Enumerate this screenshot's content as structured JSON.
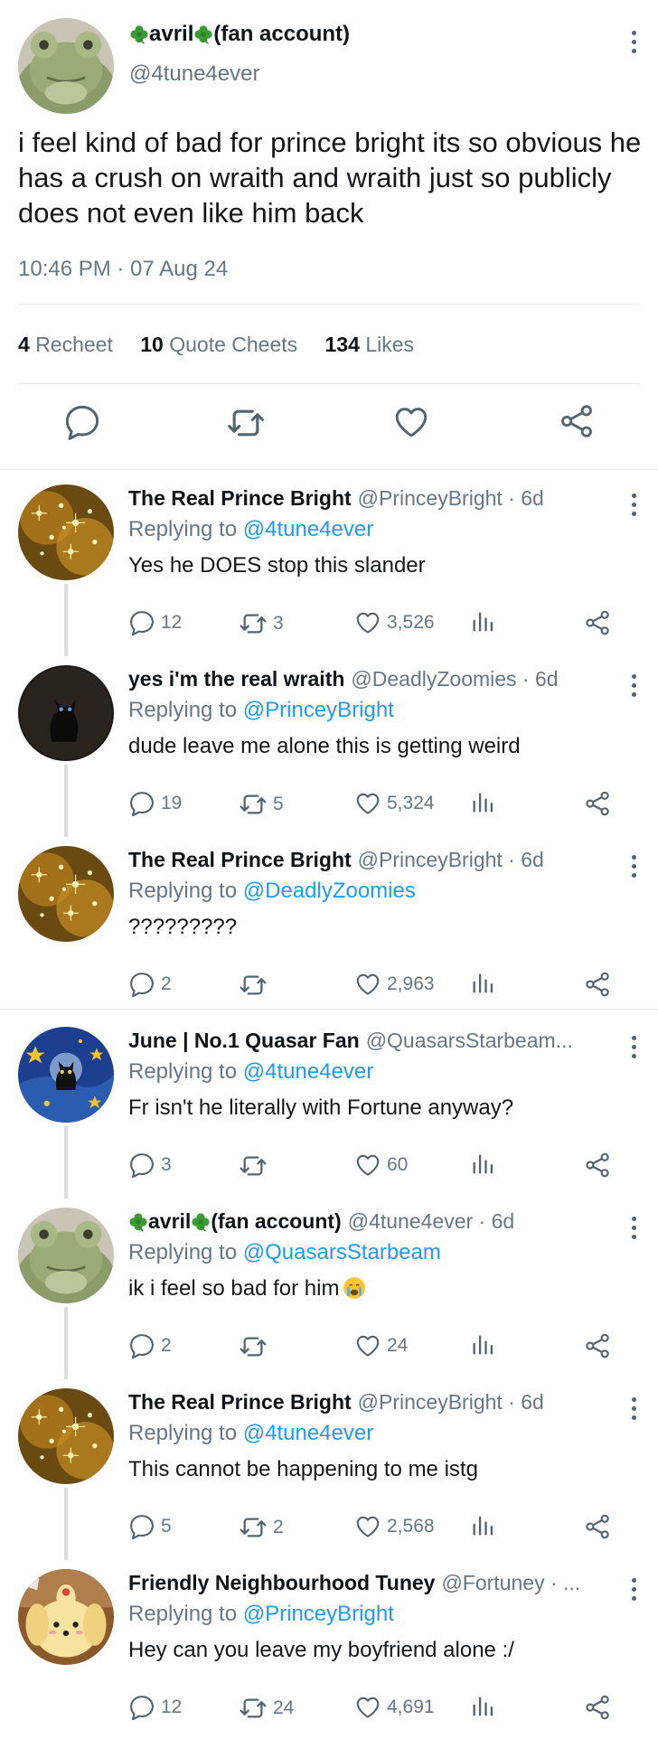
{
  "main_tweet": {
    "display_name": "avril",
    "display_suffix": "(fan account)",
    "handle": "@4tune4ever",
    "text": "i feel kind of bad for prince bright its so obvious he has a crush on wraith and wraith just so publicly does not even like him back",
    "timestamp": "10:46 PM · 07 Aug 24",
    "stats": {
      "recheets_count": "4",
      "recheets_label": "Recheet",
      "quotes_count": "10",
      "quotes_label": "Quote Cheets",
      "likes_count": "134",
      "likes_label": "Likes"
    }
  },
  "replies": [
    {
      "name": "The Real Prince Bright",
      "handle_time": "@PrinceyBright · 6d",
      "replying_label": "Replying to",
      "replying_to": "@4tune4ever",
      "text": "Yes he DOES stop this slander",
      "replies": "12",
      "recheets": "3",
      "likes": "3,526",
      "avatar": "sparkle"
    },
    {
      "name": "yes i'm the real wraith",
      "handle_time": "@DeadlyZoomies · 6d",
      "replying_label": "Replying to",
      "replying_to": "@PrinceyBright",
      "text": "dude leave me alone this is getting weird",
      "replies": "19",
      "recheets": "5",
      "likes": "5,324",
      "avatar": "dark-cat"
    },
    {
      "name": "The Real Prince Bright",
      "handle_time": "@PrinceyBright · 6d",
      "replying_label": "Replying to",
      "replying_to": "@DeadlyZoomies",
      "text": "?????????",
      "replies": "2",
      "recheets": "",
      "likes": "2,963",
      "avatar": "sparkle"
    },
    {
      "name": "June | No.1 Quasar Fan",
      "handle_time": "@QuasarsStarbeam...",
      "replying_label": "Replying to",
      "replying_to": "@4tune4ever",
      "text": "Fr isn't he literally with Fortune anyway?",
      "replies": "3",
      "recheets": "",
      "likes": "60",
      "avatar": "space-cat"
    },
    {
      "name": "avril",
      "name_suffix": "(fan account)",
      "handle_time": "@4tune4ever · 6d",
      "replying_label": "Replying to",
      "replying_to": "@QuasarsStarbeam",
      "text": "ik i feel so bad for him",
      "replies": "2",
      "recheets": "",
      "likes": "24",
      "avatar": "frog"
    },
    {
      "name": "The Real Prince Bright",
      "handle_time": "@PrinceyBright · 6d",
      "replying_label": "Replying to",
      "replying_to": "@4tune4ever",
      "text": "This cannot be happening to me istg",
      "replies": "5",
      "recheets": "2",
      "likes": "2,568",
      "avatar": "sparkle"
    },
    {
      "name": "Friendly Neighbourhood Tuney",
      "handle_time": "@Fortuney · ...",
      "replying_label": "Replying to",
      "replying_to": "@PrinceyBright",
      "text": "Hey can you leave my boyfriend alone :/",
      "replies": "12",
      "recheets": "24",
      "likes": "4,691",
      "avatar": "dog"
    }
  ],
  "icons": {
    "reply": "speech-bubble-icon",
    "recheet": "recheet-arrows-icon",
    "like": "heart-icon",
    "share": "share-icon",
    "views": "bar-chart-icon",
    "menu": "vertical-dots-icon"
  },
  "colors": {
    "link": "#1d9bf0",
    "muted": "#657786",
    "text": "#0f1419"
  }
}
